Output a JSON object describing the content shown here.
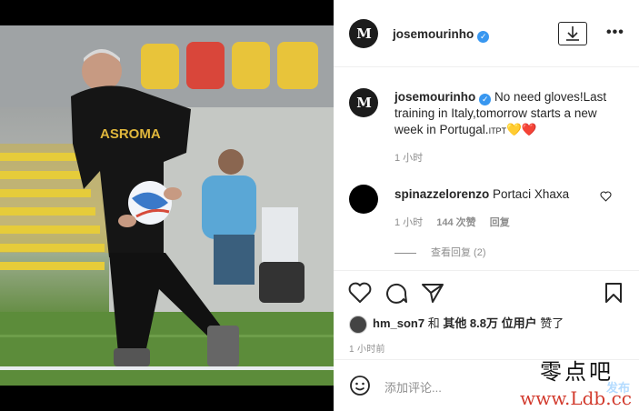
{
  "post": {
    "username": "josemourinho",
    "avatar_letters": "M",
    "caption": "No need gloves!Last training in Italy,tomorrow starts a new week in Portugal.",
    "caption_tag": "ITPT",
    "caption_emoji": "💛❤️",
    "caption_time": "1 小时",
    "photo_shirt_text": "ASROMA"
  },
  "comment": {
    "username": "spinazzelorenzo",
    "text": "Portaci Xhaxa",
    "time": "1 小时",
    "likes": "144 次赞",
    "reply": "回复",
    "view_replies": "查看回复 (2)"
  },
  "actions": {
    "liked_by_user": "hm_son7",
    "liked_mid": " 和 ",
    "liked_others": "其他 8.8万 位用户",
    "liked_end": " 赞了",
    "post_time": "1 小时前"
  },
  "add_comment": {
    "placeholder": "添加评论...",
    "post_label": "发布"
  },
  "watermark": {
    "cn": "零点吧",
    "url": "www.Ldb.cc"
  },
  "colors": {
    "verified": "#3897f0",
    "heart": "#e0245e",
    "text": "#262626",
    "muted": "#8e8e8e"
  }
}
